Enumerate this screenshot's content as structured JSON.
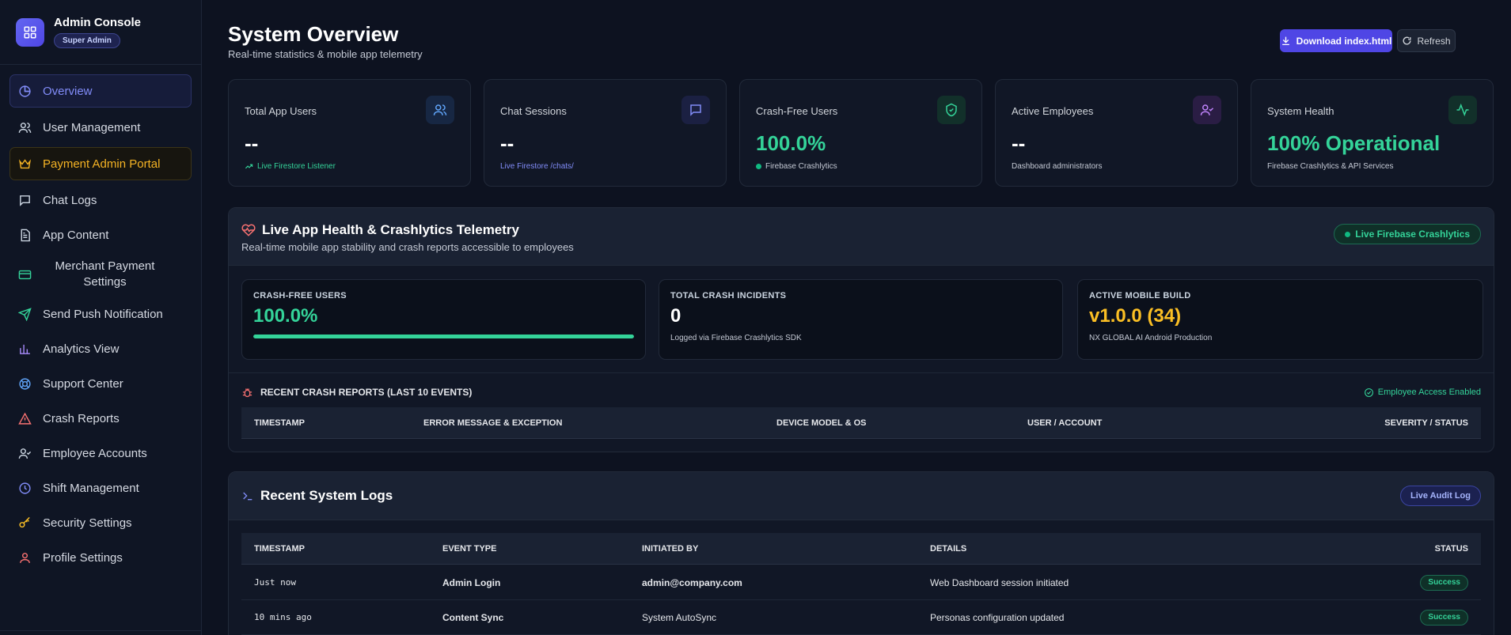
{
  "brand": {
    "title": "Admin Console",
    "role_badge": "Super Admin"
  },
  "sidebar": {
    "items": [
      {
        "label": "Overview",
        "icon": "pie-chart-icon"
      },
      {
        "label": "User Management",
        "icon": "users-icon"
      },
      {
        "label": "Payment Admin Portal",
        "icon": "crown-icon"
      },
      {
        "label": "Chat Logs",
        "icon": "message-icon"
      },
      {
        "label": "App Content",
        "icon": "file-text-icon"
      },
      {
        "label": "Merchant Payment Settings",
        "icon": "credit-card-icon"
      },
      {
        "label": "Send Push Notification",
        "icon": "send-icon"
      },
      {
        "label": "Analytics View",
        "icon": "bar-chart-icon"
      },
      {
        "label": "Support Center",
        "icon": "lifebuoy-icon"
      },
      {
        "label": "Crash Reports",
        "icon": "alert-triangle-icon"
      },
      {
        "label": "Employee Accounts",
        "icon": "user-check-icon"
      },
      {
        "label": "Shift Management",
        "icon": "clock-icon"
      },
      {
        "label": "Security Settings",
        "icon": "key-icon"
      },
      {
        "label": "Profile Settings",
        "icon": "user-icon"
      }
    ]
  },
  "header": {
    "title": "System Overview",
    "subtitle": "Real-time statistics & mobile app telemetry",
    "download_label": "Download index.html",
    "refresh_label": "Refresh"
  },
  "stats": [
    {
      "label": "Total App Users",
      "value": "--",
      "note": "Live Firestore Listener",
      "icon": "users-icon",
      "color": "#60a5fa"
    },
    {
      "label": "Chat Sessions",
      "value": "--",
      "note": "Live Firestore /chats/",
      "icon": "message-icon",
      "color": "#818cf8"
    },
    {
      "label": "Crash-Free Users",
      "value": "100.0%",
      "note": "Firebase Crashlytics",
      "icon": "shield-check-icon",
      "color": "#34d399"
    },
    {
      "label": "Active Employees",
      "value": "--",
      "note": "Dashboard administrators",
      "icon": "user-check-icon",
      "color": "#c084fc"
    },
    {
      "label": "System Health",
      "value": "100% Operational",
      "note": "Firebase Crashlytics & API Services",
      "icon": "activity-icon",
      "color": "#34d399"
    }
  ],
  "telemetry": {
    "title": "Live App Health & Crashlytics Telemetry",
    "subtitle": "Real-time mobile app stability and crash reports accessible to employees",
    "live_badge": "Live Firebase Crashlytics",
    "metrics": [
      {
        "label": "CRASH-FREE USERS",
        "value": "100.0%",
        "progress": 1.0,
        "color": "#34d399"
      },
      {
        "label": "TOTAL CRASH INCIDENTS",
        "value": "0",
        "note": "Logged via Firebase Crashlytics SDK",
        "color": "#ffffff"
      },
      {
        "label": "ACTIVE MOBILE BUILD",
        "value": "v1.0.0 (34)",
        "note": "NX GLOBAL AI Android Production",
        "color": "#fbbf24"
      }
    ],
    "reports_title": "RECENT CRASH REPORTS (LAST 10 EVENTS)",
    "access_label": "Employee Access Enabled",
    "columns": [
      "TIMESTAMP",
      "ERROR MESSAGE & EXCEPTION",
      "DEVICE MODEL & OS",
      "USER / ACCOUNT",
      "SEVERITY / STATUS"
    ]
  },
  "logs": {
    "title": "Recent System Logs",
    "badge": "Live Audit Log",
    "columns": [
      "TIMESTAMP",
      "EVENT TYPE",
      "INITIATED BY",
      "DETAILS",
      "STATUS"
    ],
    "rows": [
      {
        "time": "Just now",
        "event": "Admin Login",
        "by": "admin@company.com",
        "details": "Web Dashboard session initiated",
        "status": "Success"
      },
      {
        "time": "10 mins ago",
        "event": "Content Sync",
        "by": "System AutoSync",
        "details": "Personas configuration updated",
        "status": "Success"
      }
    ]
  }
}
